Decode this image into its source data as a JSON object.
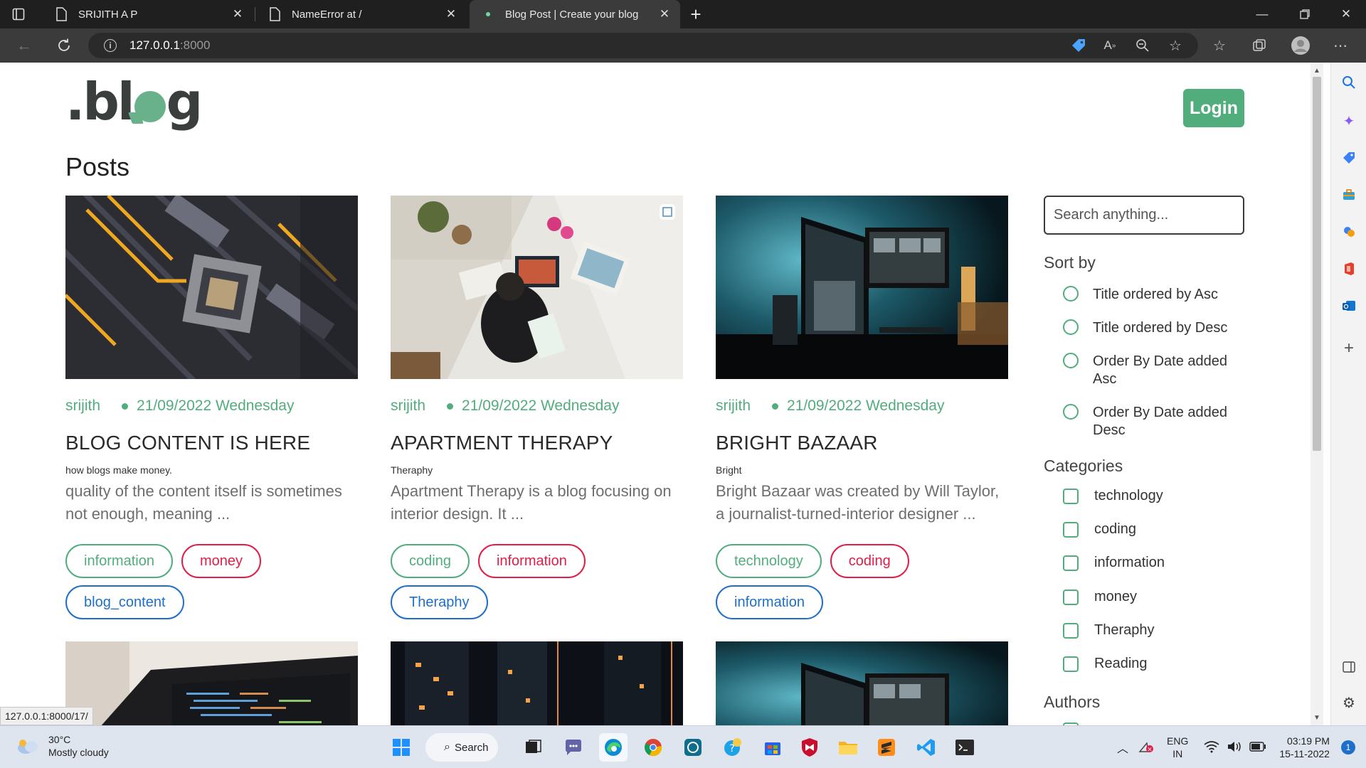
{
  "browser": {
    "tabs": [
      {
        "title": "SRIJITH A P",
        "active": false
      },
      {
        "title": "NameError at /",
        "active": false
      },
      {
        "title": "Blog Post | Create your blog",
        "active": true
      }
    ],
    "new_tab_label": "+",
    "url_host": "127.0.0.1",
    "url_port": ":8000",
    "status_url": "127.0.0.1:8000/17/"
  },
  "page": {
    "logo_text_1": ".bl",
    "logo_text_2": "g",
    "login_label": "Login",
    "posts_heading": "Posts",
    "posts": [
      {
        "author": "srijith",
        "date": "21/09/2022 Wednesday",
        "title": "BLOG CONTENT IS HERE",
        "subtitle": "how blogs make money.",
        "excerpt": "quality of the content itself is sometimes not enough, meaning ...",
        "tags": [
          {
            "label": "information",
            "color": "green"
          },
          {
            "label": "money",
            "color": "red"
          },
          {
            "label": "blog_content",
            "color": "blue"
          }
        ]
      },
      {
        "author": "srijith",
        "date": "21/09/2022 Wednesday",
        "title": "APARTMENT THERAPY",
        "subtitle": "Theraphy",
        "excerpt": "Apartment Therapy is a blog focusing on interior design. It ...",
        "tags": [
          {
            "label": "coding",
            "color": "green"
          },
          {
            "label": "information",
            "color": "red"
          },
          {
            "label": "Theraphy",
            "color": "blue"
          }
        ]
      },
      {
        "author": "srijith",
        "date": "21/09/2022 Wednesday",
        "title": "BRIGHT BAZAAR",
        "subtitle": "Bright",
        "excerpt": "Bright Bazaar was created by Will Taylor, a journalist-turned-interior designer ...",
        "tags": [
          {
            "label": "technology",
            "color": "green"
          },
          {
            "label": "coding",
            "color": "red"
          },
          {
            "label": "information",
            "color": "blue"
          }
        ]
      }
    ],
    "sidebar": {
      "search_placeholder": "Search anything...",
      "sort_heading": "Sort by",
      "sort_options": [
        "Title ordered by Asc",
        "Title ordered by Desc",
        "Order By Date added Asc",
        "Order By Date added Desc"
      ],
      "categories_heading": "Categories",
      "categories": [
        "technology",
        "coding",
        "information",
        "money",
        "Theraphy",
        "Reading"
      ],
      "authors_heading": "Authors"
    }
  },
  "taskbar": {
    "temperature": "30°C",
    "weather": "Mostly cloudy",
    "search_label": "Search",
    "lang_1": "ENG",
    "lang_2": "IN",
    "time": "03:19 PM",
    "date": "15-11-2022",
    "notification_count": "1"
  },
  "colors": {
    "accent_green": "#52ad7d",
    "tag_red": "#e11d48",
    "tag_blue": "#1e6fc9"
  }
}
